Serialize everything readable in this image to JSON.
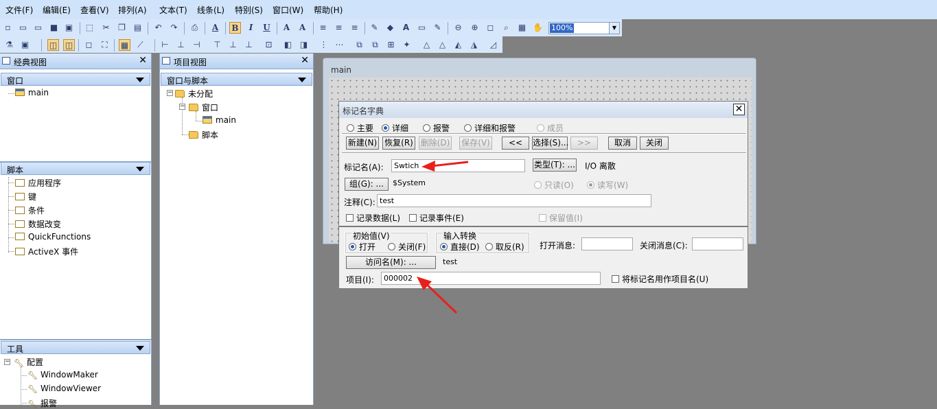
{
  "menu": [
    "文件(F)",
    "编辑(E)",
    "查看(V)",
    "排列(A)",
    "文本(T)",
    "线条(L)",
    "特别(S)",
    "窗口(W)",
    "帮助(H)"
  ],
  "toolbar": {
    "zoom_value": "100%",
    "bold": "B",
    "italic": "I",
    "underline": "U",
    "font_bigger": "A",
    "font_smaller": "A",
    "font_style": "A"
  },
  "classic_view": {
    "title": "经典视图",
    "window_section": "窗口",
    "window_items": [
      "main"
    ],
    "script_section": "脚本",
    "script_items": [
      "应用程序",
      "键",
      "条件",
      "数据改变",
      "QuickFunctions",
      "ActiveX 事件"
    ],
    "tools_section": "工具",
    "tools_root": "配置",
    "tools_items": [
      "WindowMaker",
      "WindowViewer",
      "报警"
    ]
  },
  "project_view": {
    "title": "项目视图",
    "section": "窗口与脚本",
    "root": "未分配",
    "window_folder": "窗口",
    "window_item": "main",
    "script_item": "脚本"
  },
  "canvas": {
    "title": "main"
  },
  "dialog": {
    "title": "标记名字典",
    "modes": [
      "主要",
      "详细",
      "报警",
      "详细和报警",
      "成员"
    ],
    "buttons": [
      "新建(N)",
      "恢复(R)",
      "删除(D)",
      "保存(V)",
      "<<",
      "选择(S)...",
      ">>",
      "取消",
      "关闭"
    ],
    "tagname_label": "标记名(A):",
    "tagname_value": "Swtich",
    "type_button": "类型(T): ...",
    "type_value": "I/O 离散",
    "group_button": "组(G): ...",
    "group_value": "$System",
    "readonly": "只读(O)",
    "readwrite": "读写(W)",
    "comment_label": "注释(C):",
    "comment_value": "test",
    "log_data": "记录数据(L)",
    "log_events": "记录事件(E)",
    "retain_value": "保留值(I)",
    "initial_value": {
      "title": "初始值(V)",
      "on": "打开",
      "off": "关闭(F)"
    },
    "input_conversion": {
      "title": "输入转换",
      "direct": "直接(D)",
      "reverse": "取反(R)"
    },
    "on_msg_label": "打开消息:",
    "off_msg_label": "关闭消息(C):",
    "access_button": "访问名(M): ...",
    "access_value": "test",
    "item_label": "项目(I):",
    "item_value": "000002",
    "use_tagname": "将标记名用作项目名(U)"
  }
}
